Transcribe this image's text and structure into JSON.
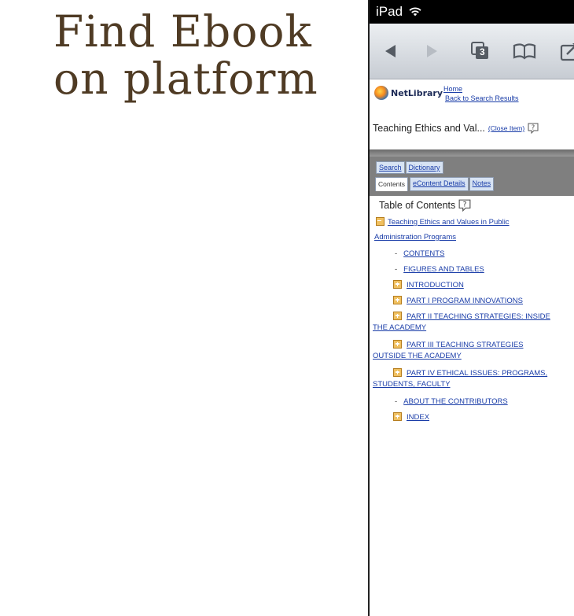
{
  "slide": {
    "title_line1": "Find Ebook",
    "title_line2": "on platform"
  },
  "ipad": {
    "status": {
      "device": "iPad",
      "wifi_icon": "wifi-icon"
    },
    "toolbar": {
      "tabs_count": "3",
      "icons": [
        "back-arrow-icon",
        "forward-arrow-icon",
        "tabs-icon",
        "bookmarks-icon",
        "share-icon"
      ]
    },
    "netlibrary": {
      "logo_text": "NetLibrary",
      "home_link": "Home",
      "back_link": "Back to Search Results"
    },
    "item": {
      "title": "Teaching Ethics and Val...",
      "close_link": "(Close Item)"
    },
    "tabs_row1": [
      "Search",
      "Dictionary"
    ],
    "tabs_row2": [
      "Contents",
      "eContent Details",
      "Notes"
    ],
    "toc": {
      "heading": "Table of Contents",
      "root_line1": "Teaching Ethics and Values in Public",
      "root_line2": "Administration Programs",
      "items": [
        {
          "type": "dash",
          "label": "CONTENTS"
        },
        {
          "type": "dash",
          "label": "FIGURES AND TABLES"
        },
        {
          "type": "plus",
          "label": "INTRODUCTION"
        },
        {
          "type": "plus",
          "label": "PART I PROGRAM INNOVATIONS"
        },
        {
          "type": "plus",
          "label": "PART II TEACHING STRATEGIES: INSIDE",
          "label2": "THE ACADEMY"
        },
        {
          "type": "plus",
          "label": "PART III TEACHING STRATEGIES",
          "label2": "OUTSIDE THE ACADEMY"
        },
        {
          "type": "plus",
          "label": "PART IV ETHICAL ISSUES: PROGRAMS,",
          "label2": "STUDENTS, FACULTY"
        },
        {
          "type": "dash",
          "label": "ABOUT THE CONTRIBUTORS"
        },
        {
          "type": "plus",
          "label": "INDEX"
        }
      ]
    }
  }
}
